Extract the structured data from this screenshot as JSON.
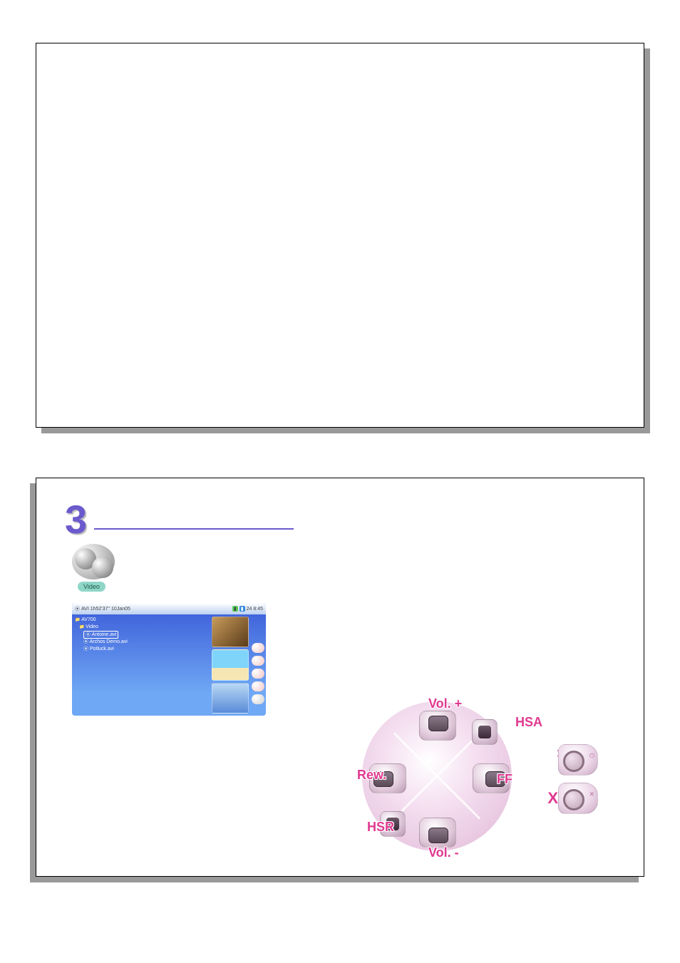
{
  "section": {
    "number": "3"
  },
  "videoIcon": {
    "label": "Video"
  },
  "screenshot": {
    "topBarLeft": "AVI 1h52'37'' 10Jan05",
    "topBarRight": "24  8:45",
    "folders": [
      "AV700",
      "Video"
    ],
    "files": [
      "Antoine.avi",
      "Archos Demo.avi",
      "Potluck.avi"
    ],
    "selectedIndex": 0
  },
  "controller": {
    "volUp": "Vol. +",
    "volDown": "Vol. -",
    "rew": "Rew.",
    "ff": "FF",
    "hsa": "HSA",
    "hsr": "HSR",
    "play": ">I",
    "stop": "X"
  }
}
